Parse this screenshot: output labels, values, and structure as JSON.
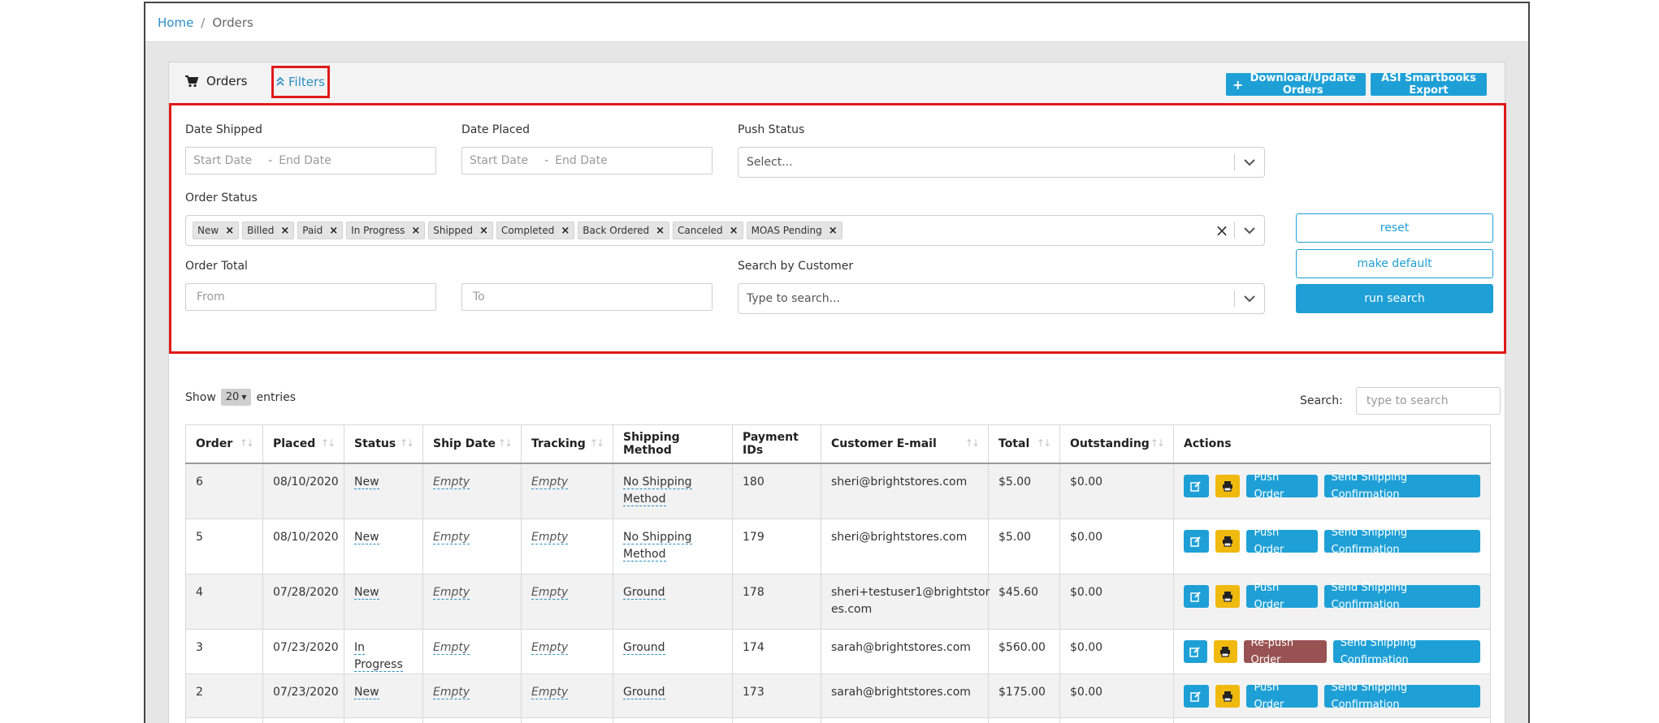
{
  "breadcrumb": {
    "home": "Home",
    "sep": "/",
    "current": "Orders"
  },
  "header": {
    "orders_tab": "Orders",
    "filters_tab": "Filters",
    "download_button": "Download/Update Orders",
    "export_button": "ASI Smartbooks Export"
  },
  "filters": {
    "date_shipped": {
      "label": "Date Shipped",
      "start": "Start Date",
      "end": "End Date"
    },
    "date_placed": {
      "label": "Date Placed",
      "start": "Start Date",
      "end": "End Date"
    },
    "push_status": {
      "label": "Push Status",
      "placeholder": "Select..."
    },
    "order_status": {
      "label": "Order Status",
      "chips": [
        "New",
        "Billed",
        "Paid",
        "In Progress",
        "Shipped",
        "Completed",
        "Back Ordered",
        "Canceled",
        "MOAS Pending"
      ]
    },
    "order_total": {
      "label": "Order Total",
      "from": "From",
      "to": "To"
    },
    "customer": {
      "label": "Search by Customer",
      "placeholder": "Type to search..."
    },
    "reset_button": "reset",
    "default_button": "make default",
    "run_button": "run search"
  },
  "table_controls": {
    "show_label": "Show",
    "entries_value": "20",
    "entries_label": "entries",
    "search_label": "Search:",
    "search_placeholder": "type to search"
  },
  "columns": [
    "Order",
    "Placed",
    "Status",
    "Ship Date",
    "Tracking",
    "Shipping Method",
    "Payment IDs",
    "Customer E-mail",
    "Total",
    "Outstanding",
    "Actions"
  ],
  "rows": [
    {
      "order": "6",
      "placed": "08/10/2020",
      "status": "New",
      "ship_date": "Empty",
      "tracking": "Empty",
      "method_line1": "No Shipping",
      "method_line2": "Method",
      "payment": "180",
      "email_line1": "sheri@brightstores.com",
      "email_line2": "",
      "total": "$5.00",
      "outstanding": "$0.00",
      "push_label": "Push Order",
      "ship_label": "Send Shipping Confirmation"
    },
    {
      "order": "5",
      "placed": "08/10/2020",
      "status": "New",
      "ship_date": "Empty",
      "tracking": "Empty",
      "method_line1": "No Shipping",
      "method_line2": "Method",
      "payment": "179",
      "email_line1": "sheri@brightstores.com",
      "email_line2": "",
      "total": "$5.00",
      "outstanding": "$0.00",
      "push_label": "Push Order",
      "ship_label": "Send Shipping Confirmation"
    },
    {
      "order": "4",
      "placed": "07/28/2020",
      "status": "New",
      "ship_date": "Empty",
      "tracking": "Empty",
      "method_line1": "Ground",
      "method_line2": "",
      "payment": "178",
      "email_line1": "sheri+testuser1@brightstor",
      "email_line2": "es.com",
      "total": "$45.60",
      "outstanding": "$0.00",
      "push_label": "Push Order",
      "ship_label": "Send Shipping Confirmation"
    },
    {
      "order": "3",
      "placed": "07/23/2020",
      "status": "In Progress",
      "ship_date": "Empty",
      "tracking": "Empty",
      "method_line1": "Ground",
      "method_line2": "",
      "payment": "174",
      "email_line1": "sarah@brightstores.com",
      "email_line2": "",
      "total": "$560.00",
      "outstanding": "$0.00",
      "push_label": "Re-push Order",
      "ship_label": "Send Shipping Confirmation"
    },
    {
      "order": "2",
      "placed": "07/23/2020",
      "status": "New",
      "ship_date": "Empty",
      "tracking": "Empty",
      "method_line1": "Ground",
      "method_line2": "",
      "payment": "173",
      "email_line1": "sarah@brightstores.com",
      "email_line2": "",
      "total": "$175.00",
      "outstanding": "$0.00",
      "push_label": "Push Order",
      "ship_label": "Send Shipping Confirmation"
    }
  ],
  "colors": {
    "accent": "#1ea0d6",
    "warning": "#f0b90e",
    "repush": "#995252",
    "highlight": "#e01a1a"
  },
  "icons": {
    "orders": "shopping-cart-icon",
    "filters": "double-chevron-up-icon",
    "edit": "edit-icon",
    "print": "print-icon",
    "caret": "chevron-down-icon"
  }
}
